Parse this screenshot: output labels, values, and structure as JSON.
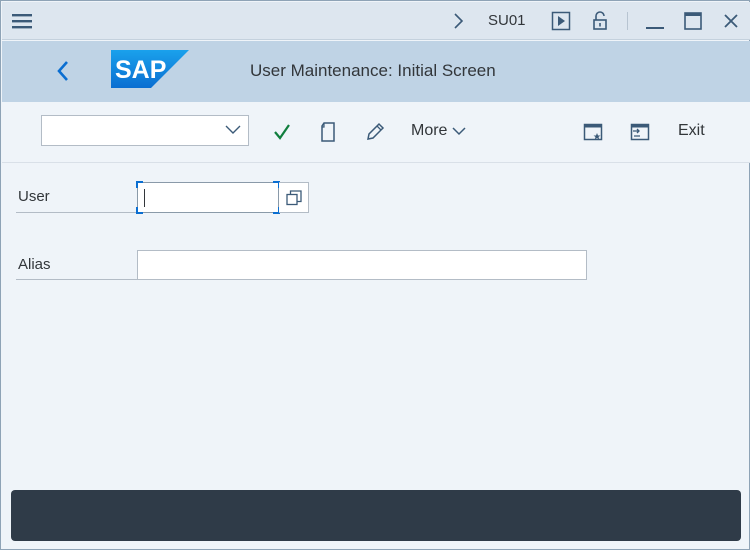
{
  "titlebar": {
    "menu_icon": "hamburger-menu-icon",
    "transaction_code": "SU01",
    "icons": [
      "chevron-right-icon",
      "play-icon",
      "unlock-icon",
      "minimize-icon",
      "maximize-icon",
      "close-icon"
    ]
  },
  "header": {
    "logo_text": "SAP",
    "title": "User Maintenance: Initial Screen",
    "brand_color": "#0a6ed1"
  },
  "toolbar": {
    "combo_value": "",
    "more_label": "More",
    "exit_label": "Exit",
    "icons": [
      "check-icon",
      "create-icon",
      "edit-icon",
      "chevron-down-icon",
      "new-window-icon",
      "switch-window-icon"
    ]
  },
  "form": {
    "user_label": "User",
    "user_value": "",
    "alias_label": "Alias",
    "alias_value": ""
  },
  "statusbar": {
    "message": ""
  }
}
